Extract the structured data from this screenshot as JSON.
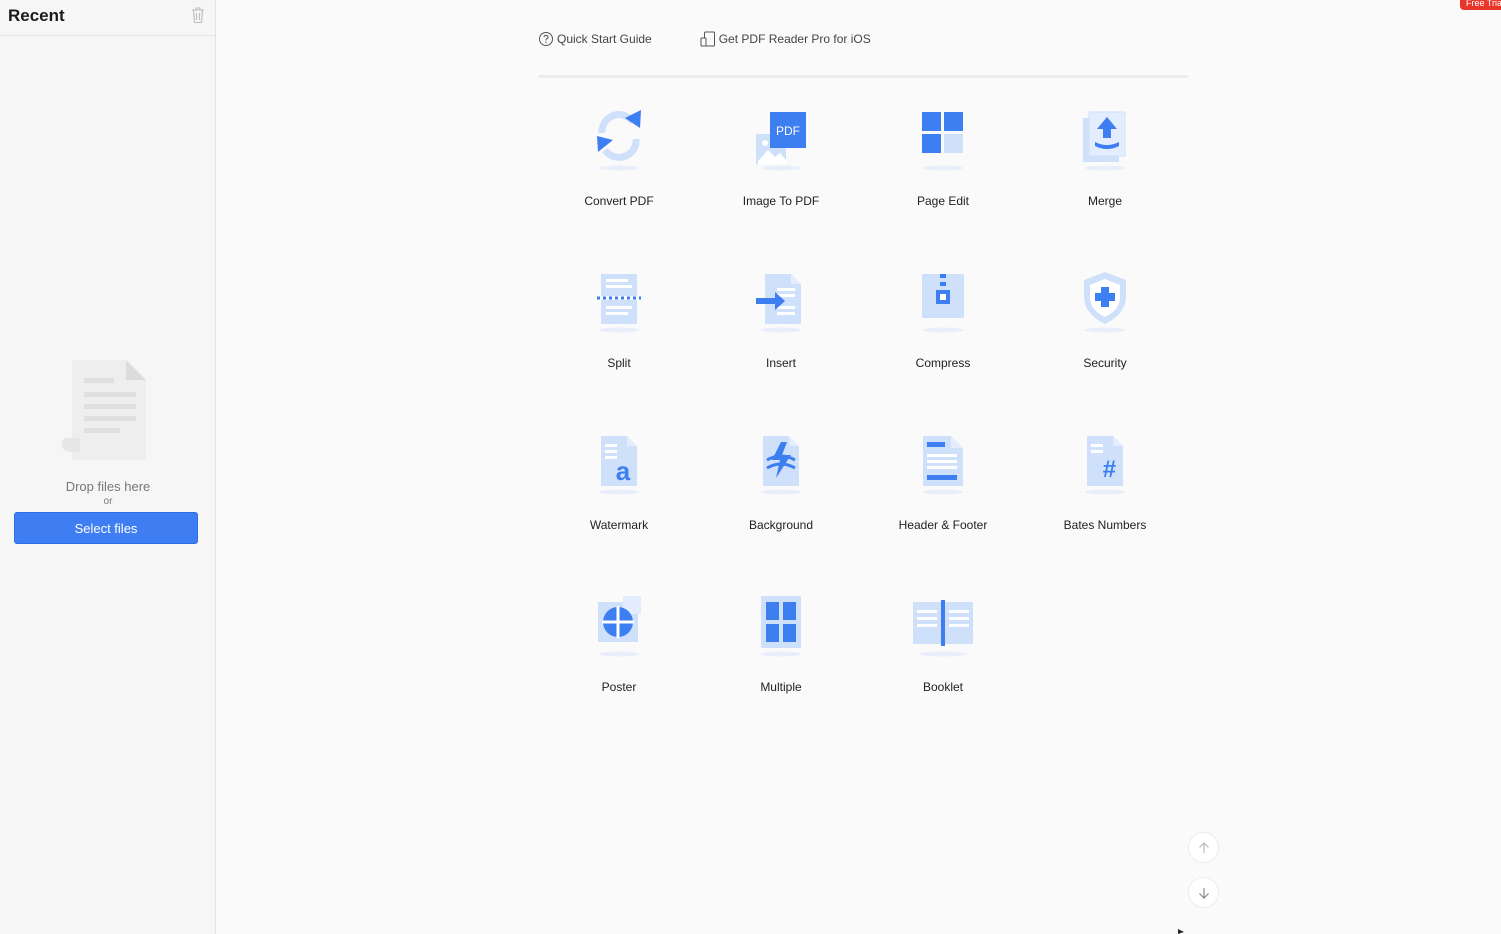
{
  "sidebar": {
    "title": "Recent",
    "drop_text": "Drop files here",
    "or_text": "or",
    "select_label": "Select files"
  },
  "top_links": {
    "quick_start": "Quick Start Guide",
    "get_ios": "Get PDF Reader Pro for iOS"
  },
  "badge": {
    "text": "Free Trial"
  },
  "tools": [
    {
      "label": "Convert PDF",
      "icon": "convert-pdf-icon"
    },
    {
      "label": "Image To PDF",
      "icon": "image-to-pdf-icon",
      "icon_text": "PDF"
    },
    {
      "label": "Page Edit",
      "icon": "page-edit-icon"
    },
    {
      "label": "Merge",
      "icon": "merge-icon"
    },
    {
      "label": "Split",
      "icon": "split-icon"
    },
    {
      "label": "Insert",
      "icon": "insert-icon"
    },
    {
      "label": "Compress",
      "icon": "compress-icon"
    },
    {
      "label": "Security",
      "icon": "security-icon"
    },
    {
      "label": "Watermark",
      "icon": "watermark-icon",
      "icon_text": "a"
    },
    {
      "label": "Background",
      "icon": "background-icon"
    },
    {
      "label": "Header & Footer",
      "icon": "header-footer-icon"
    },
    {
      "label": "Bates Numbers",
      "icon": "bates-numbers-icon",
      "icon_text": "#"
    },
    {
      "label": "Poster",
      "icon": "poster-icon"
    },
    {
      "label": "Multiple",
      "icon": "multiple-icon"
    },
    {
      "label": "Booklet",
      "icon": "booklet-icon"
    }
  ],
  "colors": {
    "accent": "#3f7ef2",
    "icon_blue": "#3d7ef0",
    "icon_light": "#cfe0fb",
    "icon_pale": "#e3edfd",
    "badge": "#e8362b"
  }
}
